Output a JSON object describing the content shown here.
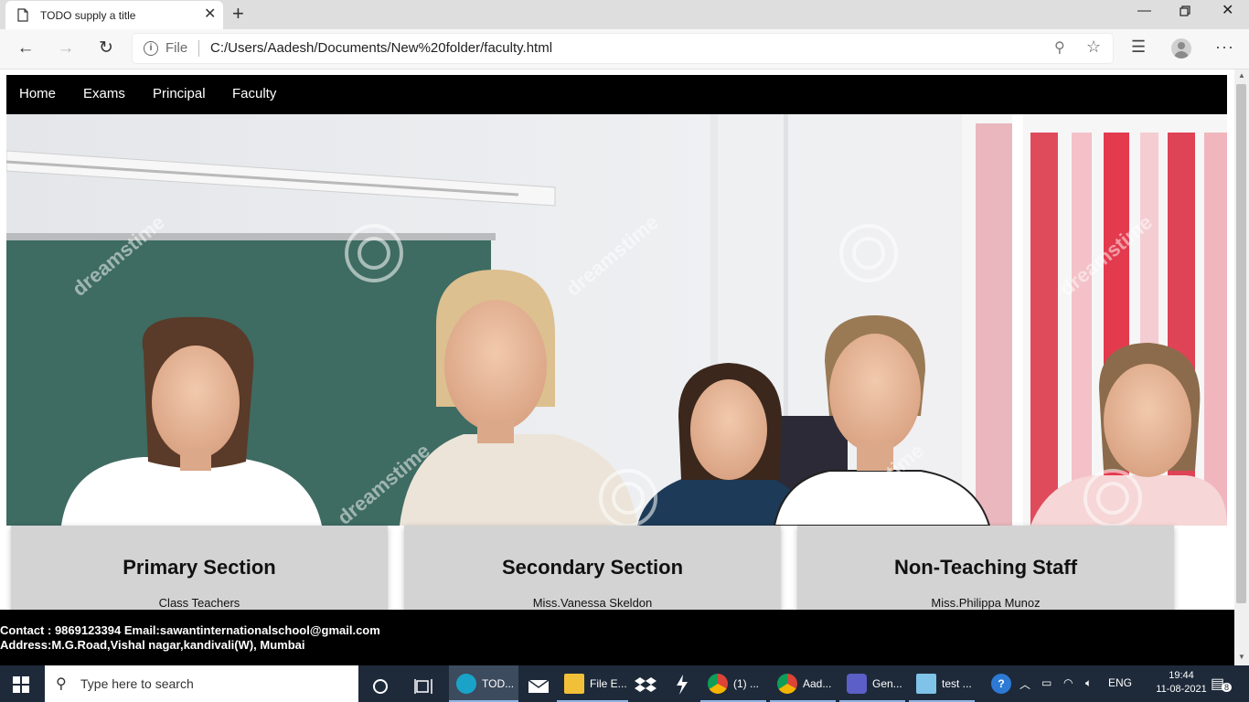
{
  "browser": {
    "tab_title": "TODO supply a title",
    "new_tab_symbol": "+",
    "address_scheme": "File",
    "address_url": "C:/Users/Aadesh/Documents/New%20folder/faculty.html",
    "icons": [
      "back-icon",
      "forward-icon",
      "refresh-icon",
      "info-icon",
      "zoom-icon",
      "favorite-star-icon",
      "favorites-icon",
      "profile-avatar-icon",
      "more-icon",
      "minimize-icon",
      "restore-icon",
      "close-icon"
    ]
  },
  "nav": {
    "items": [
      "Home",
      "Exams",
      "Principal",
      "Faculty"
    ]
  },
  "hero": {
    "watermark": "dreamstime"
  },
  "cards": [
    {
      "title": "Primary Section",
      "text": "Class Teachers"
    },
    {
      "title": "Secondary Section",
      "text": "Miss.Vanessa Skeldon"
    },
    {
      "title": "Non-Teaching Staff",
      "text": "Miss.Philippa Munoz"
    }
  ],
  "footer": {
    "contact": "Contact : 9869123394 Email:sawantinternationalschool@gmail.com",
    "address": "Address:M.G.Road,Vishal nagar,kandivali(W), Mumbai"
  },
  "taskbar": {
    "search_placeholder": "Type here to search",
    "apps": [
      {
        "label": "TOD...",
        "active": true
      },
      {
        "label": "File E..."
      },
      {
        "label": "(1) ..."
      },
      {
        "label": "Aad..."
      },
      {
        "label": "Gen..."
      },
      {
        "label": "test ..."
      }
    ],
    "lang": "ENG",
    "time": "19:44",
    "date": "11-08-2021",
    "notifications": "8"
  },
  "colors": {
    "navbar_bg": "#000000",
    "card_bg": "#d3d3d3",
    "footer_bg": "#000000",
    "taskbar_bg": "#1e2a3a"
  }
}
